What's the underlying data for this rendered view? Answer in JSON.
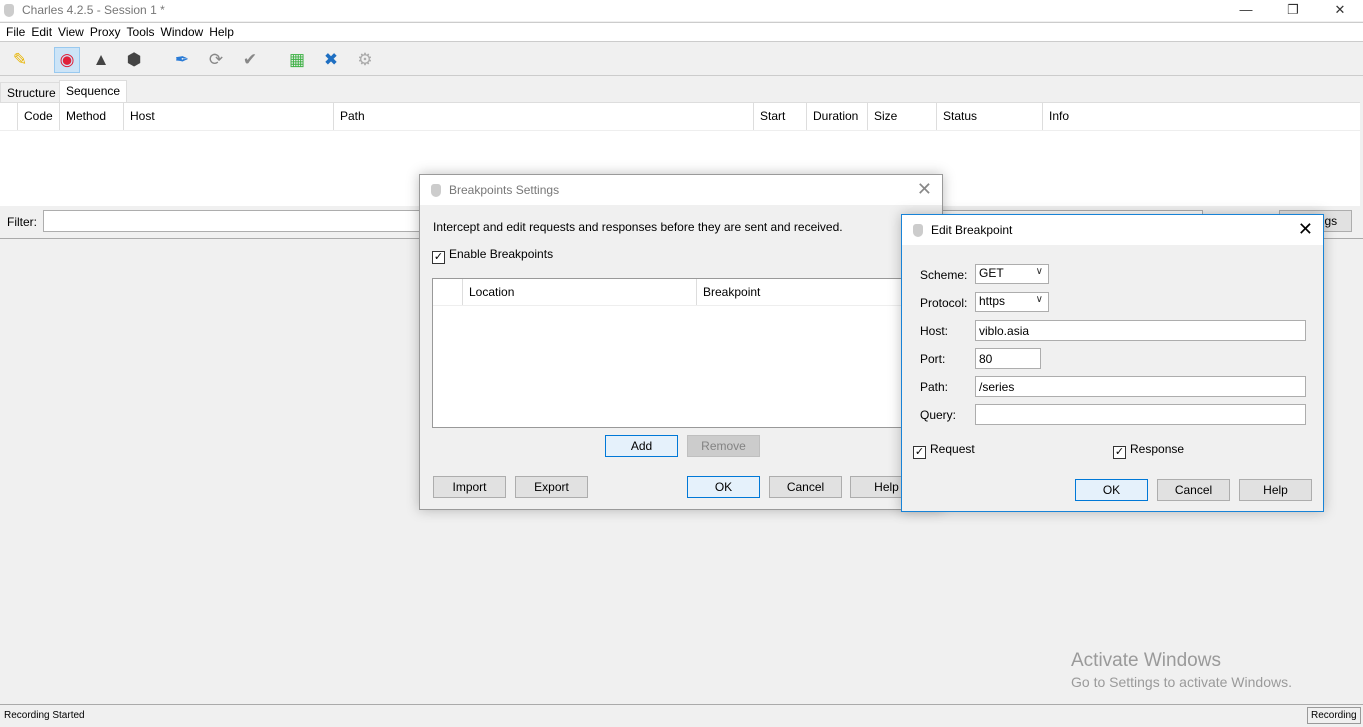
{
  "window": {
    "title": "Charles 4.2.5 - Session 1 *"
  },
  "menu": [
    "File",
    "Edit",
    "View",
    "Proxy",
    "Tools",
    "Window",
    "Help"
  ],
  "toolbar": {
    "icons": [
      "broom-icon",
      "record-icon",
      "turtle-icon",
      "stop-icon",
      "pen-icon",
      "refresh-icon",
      "check-icon",
      "basket-icon",
      "tools-icon",
      "gear-icon"
    ]
  },
  "tabs": [
    "Structure",
    "Sequence"
  ],
  "table": {
    "columns": [
      "Code",
      "Method",
      "Host",
      "Path",
      "Start",
      "Duration",
      "Size",
      "Status",
      "Info"
    ]
  },
  "filter": {
    "label": "Filter:",
    "value": "",
    "settings_label": "Settings"
  },
  "breakpoints_dialog": {
    "title": "Breakpoints Settings",
    "description": "Intercept and edit requests and responses before they are sent and received.",
    "enable_label": "Enable Breakpoints",
    "enable_checked": true,
    "columns": [
      "Location",
      "Breakpoint"
    ],
    "add": "Add",
    "remove": "Remove",
    "import": "Import",
    "export": "Export",
    "ok": "OK",
    "cancel": "Cancel",
    "help": "Help"
  },
  "edit_dialog": {
    "title": "Edit Breakpoint",
    "scheme_label": "Scheme:",
    "scheme": "GET",
    "protocol_label": "Protocol:",
    "protocol": "https",
    "host_label": "Host:",
    "host": "viblo.asia",
    "port_label": "Port:",
    "port": "80",
    "path_label": "Path:",
    "path": "/series",
    "query_label": "Query:",
    "query": "",
    "request": "Request",
    "response": "Response",
    "ok": "OK",
    "cancel": "Cancel",
    "help": "Help"
  },
  "watermark": {
    "line1": "Activate Windows",
    "line2": "Go to Settings to activate Windows."
  },
  "status": {
    "left": "Recording Started",
    "right": "Recording"
  }
}
